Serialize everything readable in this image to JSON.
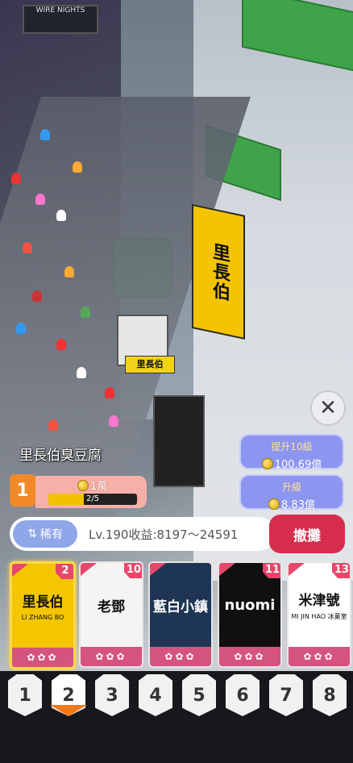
{
  "game": {
    "shop_name": "里長伯臭豆腐",
    "shop_level": "1",
    "upgrade_cost": "1萬",
    "progress_text": "2/5",
    "progress_fraction": 0.4,
    "upgrade10": {
      "label": "提升10級",
      "cost": "100.69億"
    },
    "upgrade1": {
      "label": "升級",
      "cost": "8.83億"
    },
    "rarity_label": "稀有",
    "income": "Lv.190收益:8197～24591",
    "demolish_label": "撤攤",
    "scene_signs": {
      "street_sign": "里長伯",
      "stall_sign": "里長伯",
      "top_sign": "WIRE NIGHTS"
    }
  },
  "cards": [
    {
      "title": "里長伯",
      "subtitle": "LI ZHANG BO",
      "badge": "2",
      "stars": "✿✿✿",
      "color": "#f3c600",
      "text_color": "#111"
    },
    {
      "title": "老鄧",
      "subtitle": "",
      "badge": "10",
      "stars": "✿✿✿",
      "color": "#f4f4f4",
      "text_color": "#111"
    },
    {
      "title": "藍白小鎮",
      "subtitle": "",
      "badge": "",
      "stars": "✿✿✿",
      "color": "#1e3554",
      "text_color": "#fff"
    },
    {
      "title": "nuomi",
      "subtitle": "",
      "badge": "11",
      "stars": "✿✿✿",
      "color": "#101010",
      "text_color": "#fff"
    },
    {
      "title": "米津號",
      "subtitle": "MI JIN HAO 冰菓室",
      "badge": "13",
      "stars": "✿✿✿",
      "color": "#ffffff",
      "text_color": "#111"
    }
  ],
  "slots": [
    "1",
    "2",
    "3",
    "4",
    "5",
    "6",
    "7",
    "8"
  ],
  "icons": {
    "close": "close-icon",
    "coin": "coin-icon",
    "rarity": "sort-icon"
  }
}
